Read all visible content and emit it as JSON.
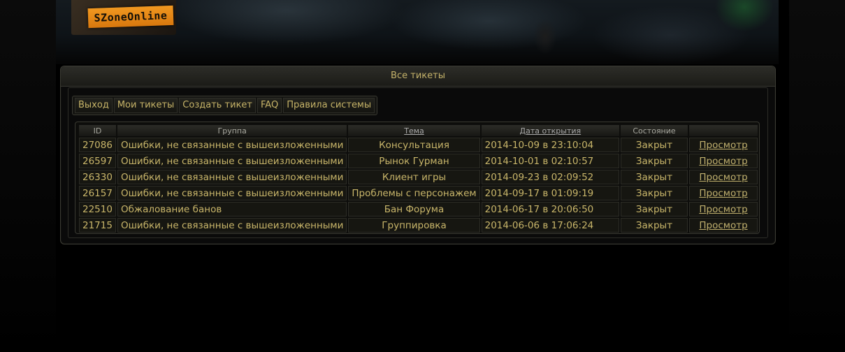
{
  "header": {
    "logo_text": "SZoneOnline"
  },
  "window": {
    "title": "Все тикеты"
  },
  "menu": [
    {
      "label": "Выход"
    },
    {
      "label": "Мои тикеты"
    },
    {
      "label": "Создать тикет"
    },
    {
      "label": "FAQ"
    },
    {
      "label": "Правила системы"
    }
  ],
  "table": {
    "columns": [
      "ID",
      "Группа",
      "Тема",
      "Дата открытия",
      "Состояние",
      ""
    ],
    "rows": [
      {
        "id": "27086",
        "group": "Ошибки, не связанные с вышеизложенными",
        "topic": "Консультация",
        "date": "2014-10-09 в 23:10:04",
        "status": "Закрыт",
        "action": "Просмотр"
      },
      {
        "id": "26597",
        "group": "Ошибки, не связанные с вышеизложенными",
        "topic": "Рынок Гурман",
        "date": "2014-10-01 в 02:10:57",
        "status": "Закрыт",
        "action": "Просмотр"
      },
      {
        "id": "26330",
        "group": "Ошибки, не связанные с вышеизложенными",
        "topic": "Клиент игры",
        "date": "2014-09-23 в 02:09:52",
        "status": "Закрыт",
        "action": "Просмотр"
      },
      {
        "id": "26157",
        "group": "Ошибки, не связанные с вышеизложенными",
        "topic": "Проблемы с персонажем",
        "date": "2014-09-17 в 01:09:19",
        "status": "Закрыт",
        "action": "Просмотр"
      },
      {
        "id": "22510",
        "group": "Обжалование банов",
        "topic": "Бан Форума",
        "date": "2014-06-17 в 20:06:50",
        "status": "Закрыт",
        "action": "Просмотр"
      },
      {
        "id": "21715",
        "group": "Ошибки, не связанные с вышеизложенными",
        "topic": "Группировка",
        "date": "2014-06-06 в 17:06:24",
        "status": "Закрыт",
        "action": "Просмотр"
      }
    ]
  }
}
